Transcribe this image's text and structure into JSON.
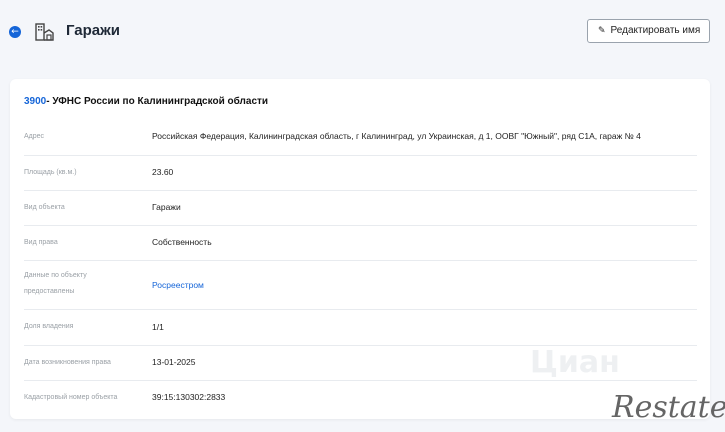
{
  "header": {
    "title": "Гаражи",
    "edit_button_label": "Редактировать имя",
    "icons": {
      "back": "arrow-left-icon",
      "page": "garage-icon",
      "edit": "pencil-icon"
    }
  },
  "card": {
    "code": "3900",
    "title": "- УФНС России по Калининградской области",
    "rows": [
      {
        "label": "Адрес",
        "value": "Российская Федерация, Калининградская область, г Калининград, ул Украинская, д 1, ООВГ \"Южный\", ряд С1А, гараж № 4"
      },
      {
        "label": "Площадь (кв.м.)",
        "value": "23.60"
      },
      {
        "label": "Вид объекта",
        "value": "Гаражи"
      },
      {
        "label": "Вид права",
        "value": "Собственность"
      },
      {
        "label": "Данные по объекту предоставлены",
        "value": "Росреестром"
      },
      {
        "label": "Доля владения",
        "value": "1/1"
      },
      {
        "label": "Дата возникновения права",
        "value": "13-01-2025"
      },
      {
        "label": "Кадастровый номер объекта",
        "value": "39:15:130302:2833"
      }
    ]
  },
  "watermarks": {
    "faint": "Циан",
    "brand": "Restate"
  },
  "colors": {
    "accent": "#1565d8",
    "background": "#f4f6fa",
    "card": "#ffffff"
  }
}
